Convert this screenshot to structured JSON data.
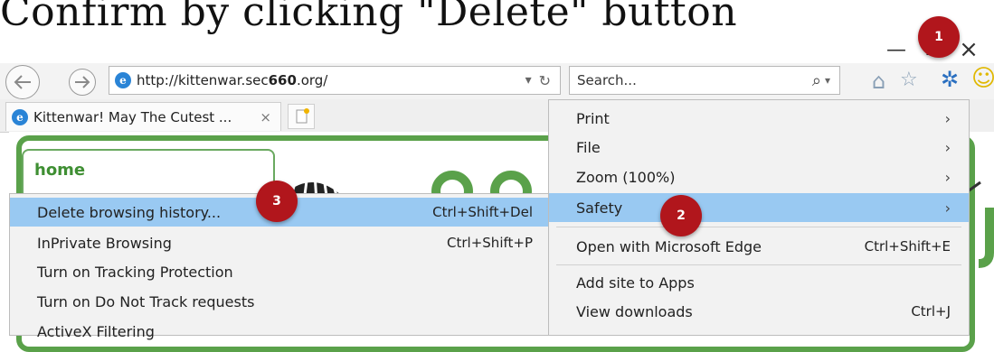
{
  "caption": "Confirm by clicking \"Delete\" button",
  "window": {
    "minimize": "—",
    "maximize": "☐",
    "close": "×"
  },
  "nav": {
    "back_icon": "back-arrow",
    "forward_icon": "forward-arrow"
  },
  "address": {
    "url_prefix": "http://kittenwar.sec",
    "url_bold": "660",
    "url_suffix": ".org/",
    "dropdown": "▾",
    "refresh": "↻"
  },
  "search": {
    "placeholder": "Search...",
    "icon": "⌕",
    "dropdown": "▾"
  },
  "toolbar_icons": {
    "home": "⌂",
    "favorites": "☆",
    "tools": "✲",
    "smiley": "☺"
  },
  "tab": {
    "title": "Kittenwar! May The Cutest ...",
    "close": "×"
  },
  "page": {
    "home_link": "home"
  },
  "main_menu": {
    "items": [
      {
        "label": "Print",
        "arrow": "›"
      },
      {
        "label": "File",
        "arrow": "›"
      },
      {
        "label": "Zoom (100%)",
        "arrow": "›"
      },
      {
        "label": "Safety",
        "arrow": "›"
      },
      {
        "label": "Open with Microsoft Edge",
        "shortcut": "Ctrl+Shift+E"
      },
      {
        "label": "Add site to Apps"
      },
      {
        "label": "View downloads",
        "shortcut": "Ctrl+J"
      }
    ]
  },
  "safety_menu": {
    "items": [
      {
        "label": "Delete browsing history...",
        "shortcut": "Ctrl+Shift+Del"
      },
      {
        "label": "InPrivate Browsing",
        "shortcut": "Ctrl+Shift+P"
      },
      {
        "label": "Turn on Tracking Protection"
      },
      {
        "label": "Turn on Do Not Track requests"
      },
      {
        "label": "ActiveX Filtering"
      }
    ]
  },
  "badges": {
    "one": "1",
    "two": "2",
    "three": "3"
  },
  "colors": {
    "highlight": "#99c9f2",
    "badge": "#b1161c",
    "frame_green": "#5aa14a"
  }
}
